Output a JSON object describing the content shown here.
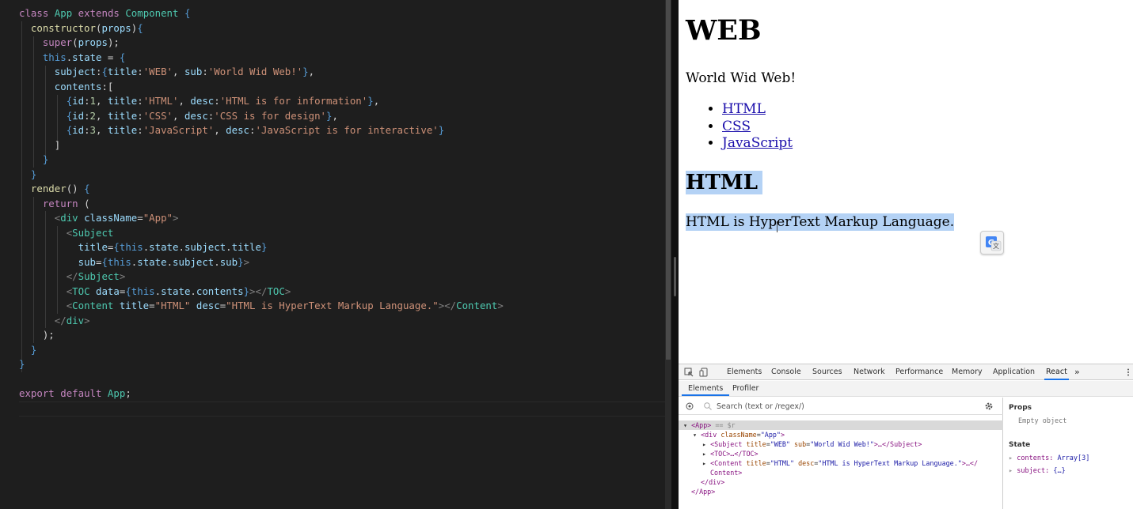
{
  "editor": {
    "lines": [
      "class App extends Component {",
      "  constructor(props){",
      "    super(props);",
      "    this.state = {",
      "      subject:{title:'WEB', sub:'World Wid Web!'},",
      "      contents:[",
      "        {id:1, title:'HTML', desc:'HTML is for information'},",
      "        {id:2, title:'CSS', desc:'CSS is for design'},",
      "        {id:3, title:'JavaScript', desc:'JavaScript is for interactive'}",
      "      ]",
      "    }",
      "  }",
      "  render() {",
      "    return (",
      "      <div className=\"App\">",
      "        <Subject",
      "          title={this.state.subject.title}",
      "          sub={this.state.subject.sub}>",
      "        </Subject>",
      "        <TOC data={this.state.contents}></TOC>",
      "        <Content title=\"HTML\" desc=\"HTML is HyperText Markup Language.\"></Content>",
      "      </div>",
      "    );",
      "  }",
      "}",
      "",
      "export default App;"
    ]
  },
  "page": {
    "title": "WEB",
    "subtitle": "World Wid Web!",
    "toc": [
      "HTML",
      "CSS",
      "JavaScript"
    ],
    "content_title": "HTML",
    "content_desc": "HTML is HyperText Markup Language."
  },
  "devtools": {
    "tabs": [
      "Elements",
      "Console",
      "Sources",
      "Network",
      "Performance",
      "Memory",
      "Application",
      "React",
      "»"
    ],
    "active_tab": "React",
    "subtabs": [
      "Elements",
      "Profiler"
    ],
    "active_subtab": "Elements",
    "search_placeholder": "Search (text or /regex/)",
    "tree": {
      "app_open": "<App>",
      "app_marker": "== $r",
      "div_open_tag": "<div",
      "div_attr": "className",
      "div_val": "\"App\"",
      "subject_tag": "<Subject",
      "subject_attr1": "title",
      "subject_val1": "\"WEB\"",
      "subject_attr2": "sub",
      "subject_val2": "\"World Wid Web!\"",
      "subject_close": ">…</Subject>",
      "toc": "<TOC>…</TOC>",
      "content_tag": "<Content",
      "content_attr1": "title",
      "content_val1": "\"HTML\"",
      "content_attr2": "desc",
      "content_val2": "\"HTML is HyperText Markup Language.\"",
      "content_close1": ">…</",
      "content_close2": "Content>",
      "div_close": "</div>",
      "app_close": "</App>"
    },
    "side": {
      "props_heading": "Props",
      "props_empty": "Empty object",
      "state_heading": "State",
      "state_items": [
        {
          "key": "contents:",
          "value": "Array[3]"
        },
        {
          "key": "subject:",
          "value": "{…}"
        }
      ]
    }
  },
  "colors": {
    "editor_bg": "#1e1e1e",
    "keyword": "#c586c0",
    "class_name": "#4ec9b0",
    "string": "#ce9178",
    "selection": "#b4d2f5",
    "link": "#1a0dab",
    "devtools_accent": "#1a73e8"
  }
}
